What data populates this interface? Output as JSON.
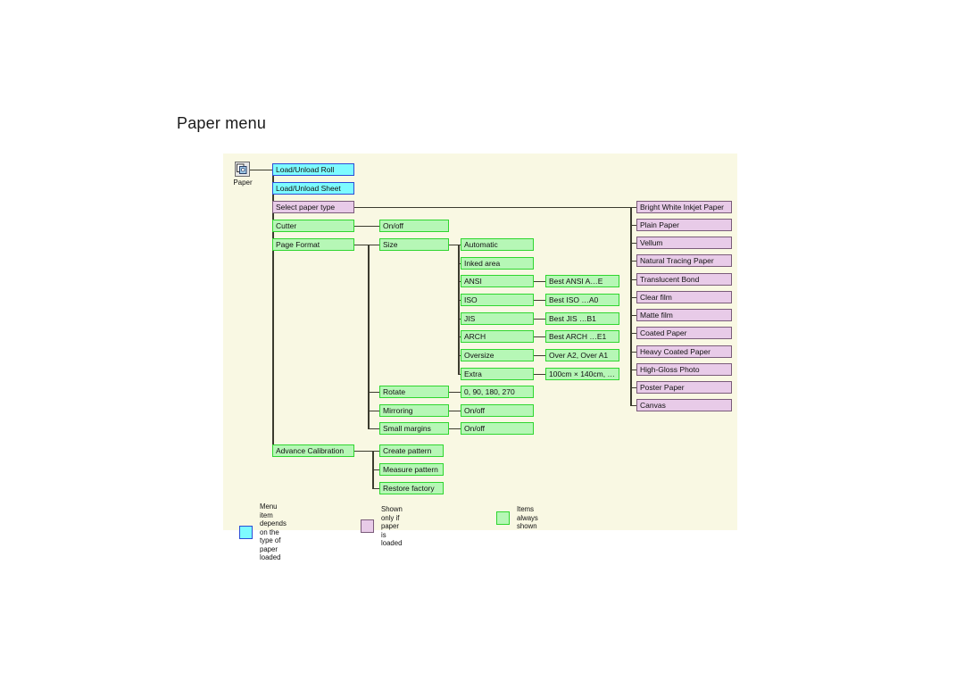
{
  "page": {
    "title": "Paper menu"
  },
  "diagram": {
    "root": {
      "icon": "paper-stack-icon",
      "label": "Paper"
    },
    "level1": [
      {
        "label": "Load/Unload Roll",
        "type": "blue"
      },
      {
        "label": "Load/Unload Sheet",
        "type": "blue"
      },
      {
        "label": "Select paper type",
        "type": "purple"
      },
      {
        "label": "Cutter",
        "type": "green"
      },
      {
        "label": "Page Format",
        "type": "green"
      },
      {
        "label": "Advance Calibration",
        "type": "green"
      }
    ],
    "cutter_children": [
      {
        "label": "On/off",
        "type": "green"
      }
    ],
    "page_format_children": [
      {
        "label": "Size",
        "type": "green"
      },
      {
        "label": "Rotate",
        "type": "green"
      },
      {
        "label": "Mirroring",
        "type": "green"
      },
      {
        "label": "Small margins",
        "type": "green"
      }
    ],
    "page_format_values": [
      {
        "label": "0, 90, 180, 270",
        "type": "green"
      },
      {
        "label": "On/off",
        "type": "green"
      },
      {
        "label": "On/off",
        "type": "green"
      }
    ],
    "size_children": [
      {
        "label": "Automatic",
        "type": "green"
      },
      {
        "label": "Inked area",
        "type": "green"
      },
      {
        "label": "ANSI",
        "type": "green"
      },
      {
        "label": "ISO",
        "type": "green"
      },
      {
        "label": "JIS",
        "type": "green"
      },
      {
        "label": "ARCH",
        "type": "green"
      },
      {
        "label": "Oversize",
        "type": "green"
      },
      {
        "label": "Extra",
        "type": "green"
      }
    ],
    "size_values": [
      {
        "label": "Best ANSI A…E",
        "type": "green"
      },
      {
        "label": "Best ISO …A0",
        "type": "green"
      },
      {
        "label": "Best JIS …B1",
        "type": "green"
      },
      {
        "label": "Best ARCH …E1",
        "type": "green"
      },
      {
        "label": "Over A2, Over A1",
        "type": "green"
      },
      {
        "label": "100cm × 140cm, …",
        "type": "green"
      }
    ],
    "calibration_children": [
      {
        "label": "Create pattern",
        "type": "green"
      },
      {
        "label": "Measure pattern",
        "type": "green"
      },
      {
        "label": "Restore factory",
        "type": "green"
      }
    ],
    "paper_types": [
      {
        "label": "Bright White Inkjet Paper",
        "type": "purple"
      },
      {
        "label": "Plain Paper",
        "type": "purple"
      },
      {
        "label": "Vellum",
        "type": "purple"
      },
      {
        "label": "Natural Tracing Paper",
        "type": "purple"
      },
      {
        "label": "Translucent Bond",
        "type": "purple"
      },
      {
        "label": "Clear film",
        "type": "purple"
      },
      {
        "label": "Matte film",
        "type": "purple"
      },
      {
        "label": "Coated Paper",
        "type": "purple"
      },
      {
        "label": "Heavy Coated Paper",
        "type": "purple"
      },
      {
        "label": "High-Gloss Photo",
        "type": "purple"
      },
      {
        "label": "Poster Paper",
        "type": "purple"
      },
      {
        "label": "Canvas",
        "type": "purple"
      }
    ],
    "legend": [
      {
        "swatch": "blue",
        "text": "Menu item depends on the\ntype of paper loaded"
      },
      {
        "swatch": "purple",
        "text": "Shown only if paper is loaded"
      },
      {
        "swatch": "green",
        "text": "Items always shown"
      }
    ],
    "colors": {
      "canvas_background": "#f9f8e3",
      "blue_fill": "#7dfbff",
      "blue_border": "#2b4cd6",
      "green_fill": "#b6f7b6",
      "green_border": "#2fd62f",
      "purple_fill": "#e8cbe8",
      "purple_border": "#7a5b7a",
      "connector": "#3b3b2e"
    }
  }
}
